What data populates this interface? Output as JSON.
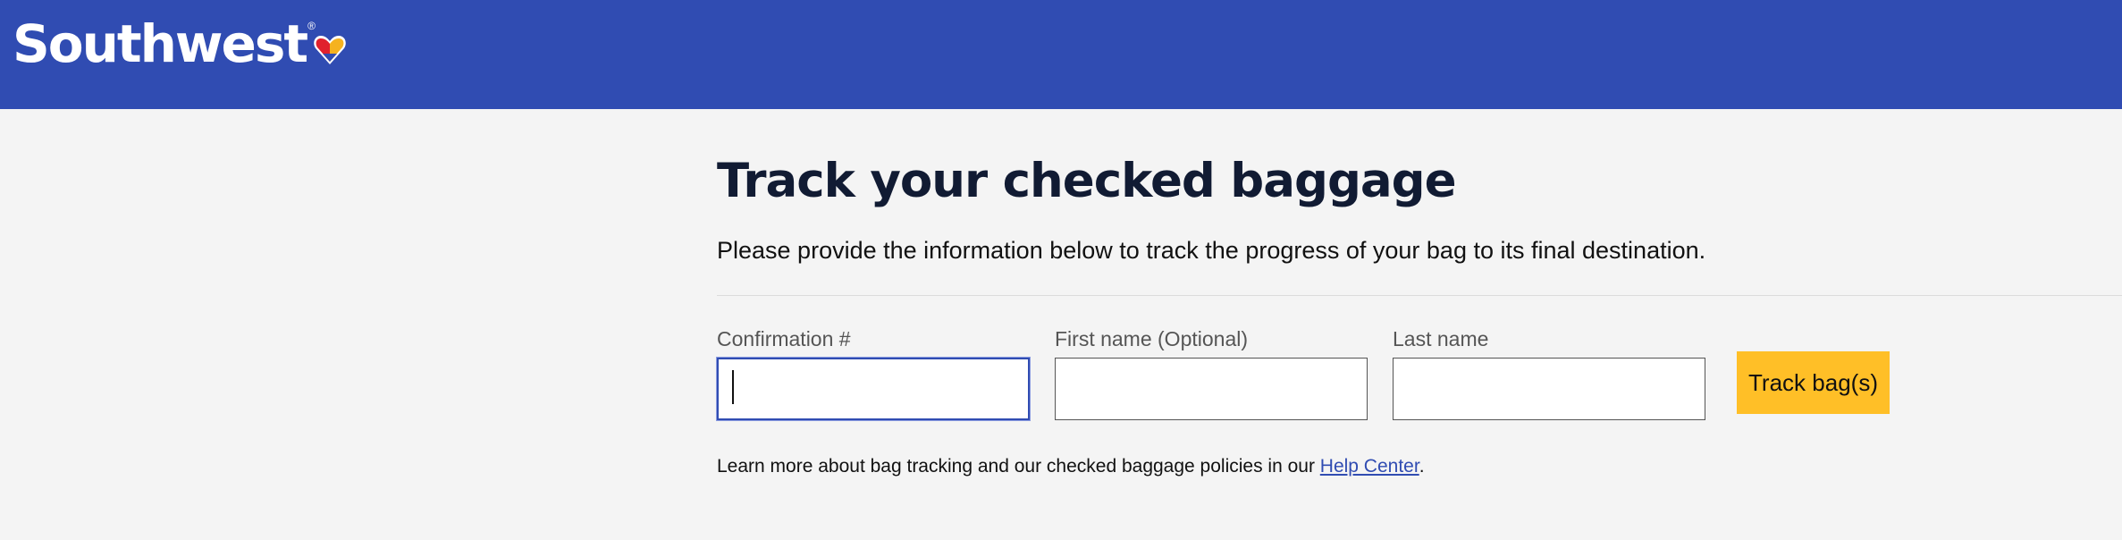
{
  "header": {
    "logo_text": "Southwest",
    "logo_reg": "®",
    "logo_icon": "heart-logo-icon",
    "background": "#304cb2"
  },
  "main": {
    "title": "Track your checked baggage",
    "subtitle": "Please provide the information below to track the progress of your bag to its final destination."
  },
  "form": {
    "confirmation_label": "Confirmation #",
    "confirmation_value": "",
    "first_name_label": "First name (Optional)",
    "first_name_value": "",
    "last_name_label": "Last name",
    "last_name_value": "",
    "submit_label": "Track bag(s)",
    "submit_color": "#ffbf27"
  },
  "help": {
    "text_before": "Learn more about bag tracking and our checked baggage policies in our ",
    "link_label": "Help Center",
    "text_after": "."
  }
}
